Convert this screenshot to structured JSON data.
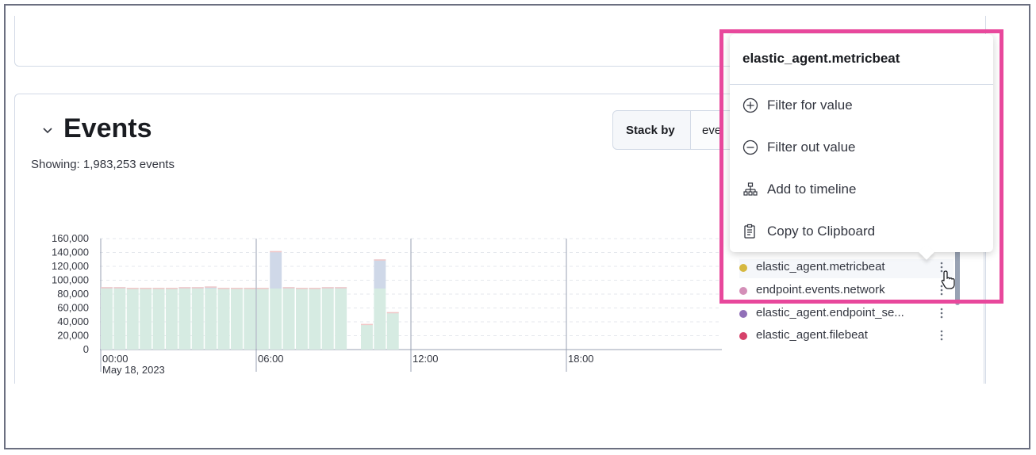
{
  "events": {
    "title": "Events",
    "showing": "Showing: 1,983,253 events",
    "stack_by_label": "Stack by",
    "stack_by_value": "eve"
  },
  "chart_data": {
    "type": "bar",
    "stacked": true,
    "y_ticks": [
      "160,000",
      "140,000",
      "120,000",
      "100,000",
      "80,000",
      "60,000",
      "40,000",
      "20,000",
      "0"
    ],
    "x_ticks": [
      "00:00",
      "06:00",
      "12:00",
      "18:00"
    ],
    "x_sublabel": "May 18, 2023",
    "ylim": [
      0,
      160000
    ],
    "bar_slots": 23,
    "bars": [
      {
        "slot": 0,
        "value": 90000
      },
      {
        "slot": 1,
        "value": 90000
      },
      {
        "slot": 2,
        "value": 89000
      },
      {
        "slot": 3,
        "value": 89000
      },
      {
        "slot": 4,
        "value": 89000
      },
      {
        "slot": 5,
        "value": 89000
      },
      {
        "slot": 6,
        "value": 90000
      },
      {
        "slot": 7,
        "value": 90000
      },
      {
        "slot": 8,
        "value": 91000
      },
      {
        "slot": 9,
        "value": 89000
      },
      {
        "slot": 10,
        "value": 89000
      },
      {
        "slot": 11,
        "value": 89000
      },
      {
        "slot": 12,
        "value": 89000
      },
      {
        "slot": 13,
        "value": 142000
      },
      {
        "slot": 14,
        "value": 90000
      },
      {
        "slot": 15,
        "value": 89000
      },
      {
        "slot": 16,
        "value": 89000
      },
      {
        "slot": 17,
        "value": 90000
      },
      {
        "slot": 18,
        "value": 90000
      },
      {
        "slot": 20,
        "value": 37000
      },
      {
        "slot": 21,
        "value": 130000
      },
      {
        "slot": 22,
        "value": 54000
      }
    ],
    "colors": {
      "base": "#d6ebe2",
      "top": "#cfd8e8",
      "bar_edge": "#f2c7c7",
      "grid": "#e4e7ec",
      "axis": "#98a2b3"
    }
  },
  "legend": [
    {
      "label": "elastic_agent.metricbeat",
      "color": "#d6b840"
    },
    {
      "label": "endpoint.events.network",
      "color": "#d48fb8"
    },
    {
      "label": "elastic_agent.endpoint_se...",
      "color": "#9170b8"
    },
    {
      "label": "elastic_agent.filebeat",
      "color": "#d6416a"
    }
  ],
  "popover": {
    "title": "elastic_agent.metricbeat",
    "items": [
      {
        "label": "Filter for value",
        "icon": "plus-circle-icon"
      },
      {
        "label": "Filter out value",
        "icon": "minus-circle-icon"
      },
      {
        "label": "Add to timeline",
        "icon": "timeline-icon"
      },
      {
        "label": "Copy to Clipboard",
        "icon": "clipboard-icon"
      }
    ]
  },
  "colors": {
    "highlight": "#e8489c"
  }
}
